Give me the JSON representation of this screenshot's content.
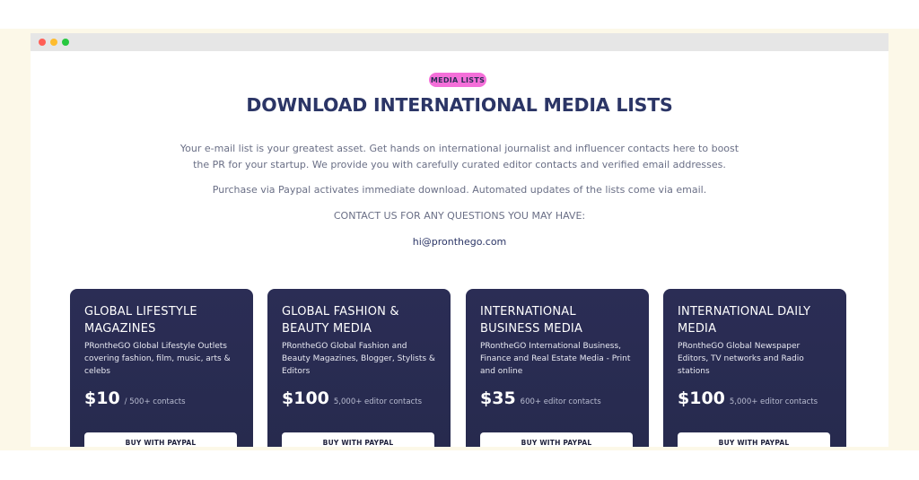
{
  "badge": "MEDIA LISTS",
  "title": "DOWNLOAD INTERNATIONAL MEDIA LISTS",
  "intro_line1": "Your e-mail list is your greatest asset. Get hands on international journalist and influencer contacts here to boost",
  "intro_line2": "the PR for your startup. We provide you with carefully curated editor contacts and verified email addresses.",
  "purchase_note": "Purchase via Paypal activates immediate download. Automated updates of the lists come via email.",
  "contact_heading": "CONTACT US FOR ANY QUESTIONS YOU MAY HAVE:",
  "email": "hi@pronthego.com",
  "cards": [
    {
      "title_line1": "GLOBAL LIFESTYLE",
      "title_line2": "MAGAZINES",
      "description": "PRontheGO Global Lifestyle Outlets covering fashion, film, music, arts & celebs",
      "price": "$10",
      "contacts": "/ 500+ contacts",
      "button": "BUY WITH PAYPAL"
    },
    {
      "title_line1": "GLOBAL FASHION &",
      "title_line2": "BEAUTY MEDIA",
      "description": "PRontheGO Global Fashion and Beauty Magazines, Blogger, Stylists & Editors",
      "price": "$100",
      "contacts": "5,000+ editor contacts",
      "button": "BUY WITH PAYPAL"
    },
    {
      "title_line1": "INTERNATIONAL",
      "title_line2": "BUSINESS MEDIA",
      "description": "PRontheGO International Business, Finance and Real Estate Media - Print and online",
      "price": "$35",
      "contacts": "600+ editor contacts",
      "button": "BUY WITH PAYPAL"
    },
    {
      "title_line1": "INTERNATIONAL DAILY",
      "title_line2": "MEDIA",
      "description": "PRontheGO Global Newspaper Editors, TV networks and Radio stations",
      "price": "$100",
      "contacts": "5,000+ editor contacts",
      "button": "BUY WITH PAYPAL"
    }
  ]
}
